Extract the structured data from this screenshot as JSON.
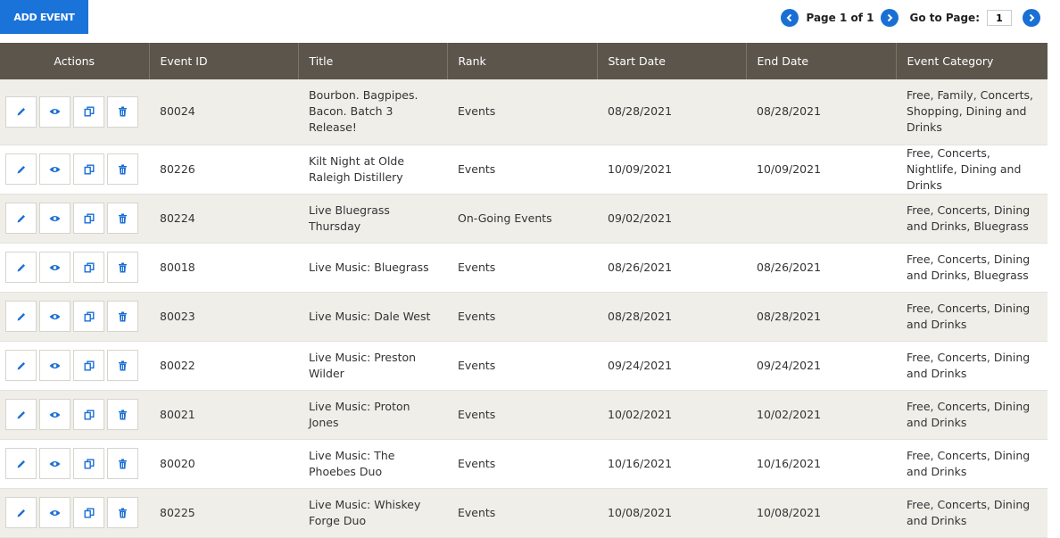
{
  "toolbar": {
    "add_label": "ADD EVENT"
  },
  "pager": {
    "prev_icon": "chevron-left-icon",
    "status": "Page 1 of 1",
    "next_icon": "chevron-right-icon",
    "goto_label": "Go to Page:",
    "goto_value": "1",
    "go_icon": "chevron-right-icon"
  },
  "colors": {
    "accent": "#1a73d9",
    "header_bg": "#5b554c",
    "row_alt": "#efeee9"
  },
  "table": {
    "headers": [
      "Actions",
      "Event ID",
      "Title",
      "Rank",
      "Start Date",
      "End Date",
      "Event Category"
    ],
    "action_icons": [
      "pencil-icon",
      "eye-icon",
      "copy-icon",
      "trash-icon"
    ],
    "rows": [
      {
        "id": "80024",
        "title": "Bourbon. Bagpipes. Bacon. Batch 3 Release!",
        "rank": "Events",
        "start": "08/28/2021",
        "end": "08/28/2021",
        "category": "Free, Family, Concerts, Shopping, Dining and Drinks"
      },
      {
        "id": "80226",
        "title": "Kilt Night at Olde Raleigh Distillery",
        "rank": "Events",
        "start": "10/09/2021",
        "end": "10/09/2021",
        "category": "Free, Concerts, Nightlife, Dining and Drinks"
      },
      {
        "id": "80224",
        "title": "Live Bluegrass Thursday",
        "rank": "On-Going Events",
        "start": "09/02/2021",
        "end": "",
        "category": "Free, Concerts, Dining and Drinks, Bluegrass"
      },
      {
        "id": "80018",
        "title": "Live Music: Bluegrass",
        "rank": "Events",
        "start": "08/26/2021",
        "end": "08/26/2021",
        "category": "Free, Concerts, Dining and Drinks, Bluegrass"
      },
      {
        "id": "80023",
        "title": "Live Music: Dale West",
        "rank": "Events",
        "start": "08/28/2021",
        "end": "08/28/2021",
        "category": "Free, Concerts, Dining and Drinks"
      },
      {
        "id": "80022",
        "title": "Live Music: Preston Wilder",
        "rank": "Events",
        "start": "09/24/2021",
        "end": "09/24/2021",
        "category": "Free, Concerts, Dining and Drinks"
      },
      {
        "id": "80021",
        "title": "Live Music: Proton Jones",
        "rank": "Events",
        "start": "10/02/2021",
        "end": "10/02/2021",
        "category": "Free, Concerts, Dining and Drinks"
      },
      {
        "id": "80020",
        "title": "Live Music: The Phoebes Duo",
        "rank": "Events",
        "start": "10/16/2021",
        "end": "10/16/2021",
        "category": "Free, Concerts, Dining and Drinks"
      },
      {
        "id": "80225",
        "title": "Live Music: Whiskey Forge Duo",
        "rank": "Events",
        "start": "10/08/2021",
        "end": "10/08/2021",
        "category": "Free, Concerts, Dining and Drinks"
      }
    ]
  }
}
